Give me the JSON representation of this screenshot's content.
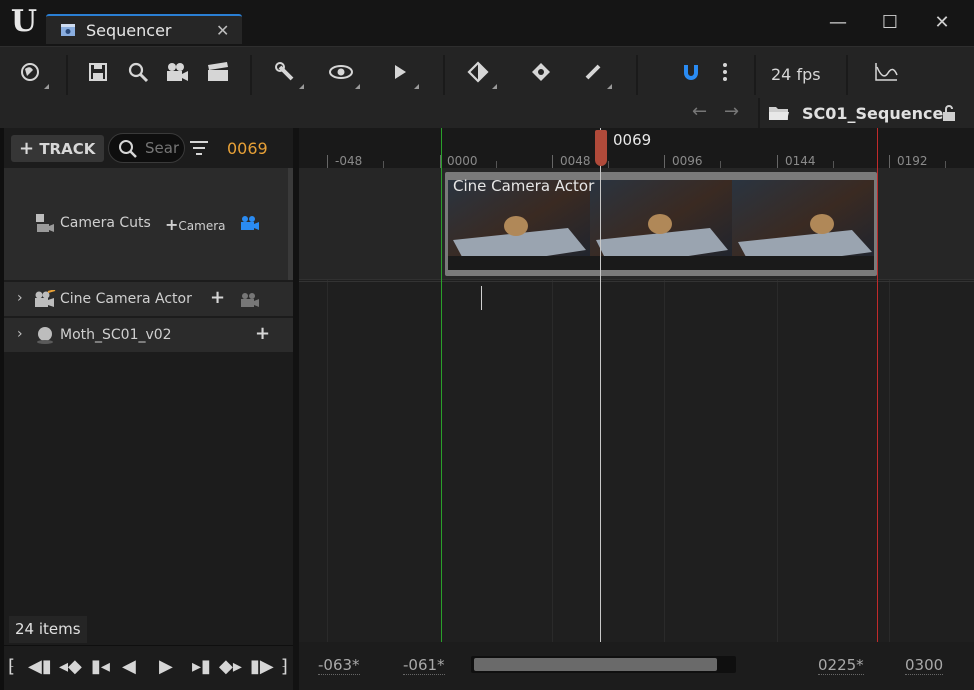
{
  "window": {
    "tab_title": "Sequencer",
    "tab_close": "✕",
    "minimize": "—",
    "maximize": "☐",
    "close": "✕"
  },
  "toolbar": {
    "fps": "24 fps"
  },
  "nav": {
    "back": "←",
    "forward": "→",
    "sequence_name": "SC01_Sequence"
  },
  "outliner": {
    "track_button": "TRACK",
    "search_placeholder": "Search",
    "current_frame": "0069",
    "camera_cuts": {
      "label": "Camera Cuts",
      "add_camera": "Camera"
    },
    "rows": [
      {
        "label": "Cine Camera Actor"
      },
      {
        "label": "Moth_SC01_v02"
      }
    ],
    "items_count": "24 items"
  },
  "timeline": {
    "ticks": [
      "-048",
      "0000",
      "0048",
      "0096",
      "0144",
      "0192"
    ],
    "playhead_label": "0069",
    "shot_label": "Cine Camera Actor",
    "range": {
      "view_start": "-063*",
      "work_start": "-061*",
      "work_end": "0225*",
      "view_end": "0300"
    }
  }
}
